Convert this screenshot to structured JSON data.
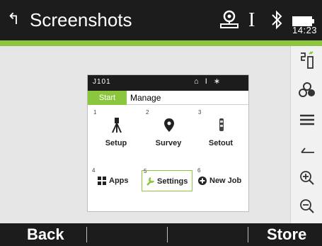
{
  "title": "Screenshots",
  "status": {
    "clock": "14:23"
  },
  "preview": {
    "job": "J101",
    "status_icons": "⌂ I ∗",
    "tabs": {
      "start": "Start",
      "manage": "Manage"
    },
    "tiles": [
      {
        "num": "1",
        "label": "Setup"
      },
      {
        "num": "2",
        "label": "Survey"
      },
      {
        "num": "3",
        "label": "Setout"
      }
    ],
    "buttons": [
      {
        "num": "4",
        "label": "Apps"
      },
      {
        "num": "5",
        "label": "Settings"
      },
      {
        "num": "6",
        "label": "New Job"
      }
    ]
  },
  "toolbar": {
    "icons": [
      "units-toggle-icon",
      "group-icon",
      "menu-icon",
      "back-icon",
      "zoom-in-icon",
      "zoom-out-icon"
    ]
  },
  "softkeys": {
    "f1": "Back",
    "f6": "Store"
  },
  "colors": {
    "accent": "#8cc63f",
    "bar": "#1c1c1c",
    "background": "#e6e6e6"
  }
}
